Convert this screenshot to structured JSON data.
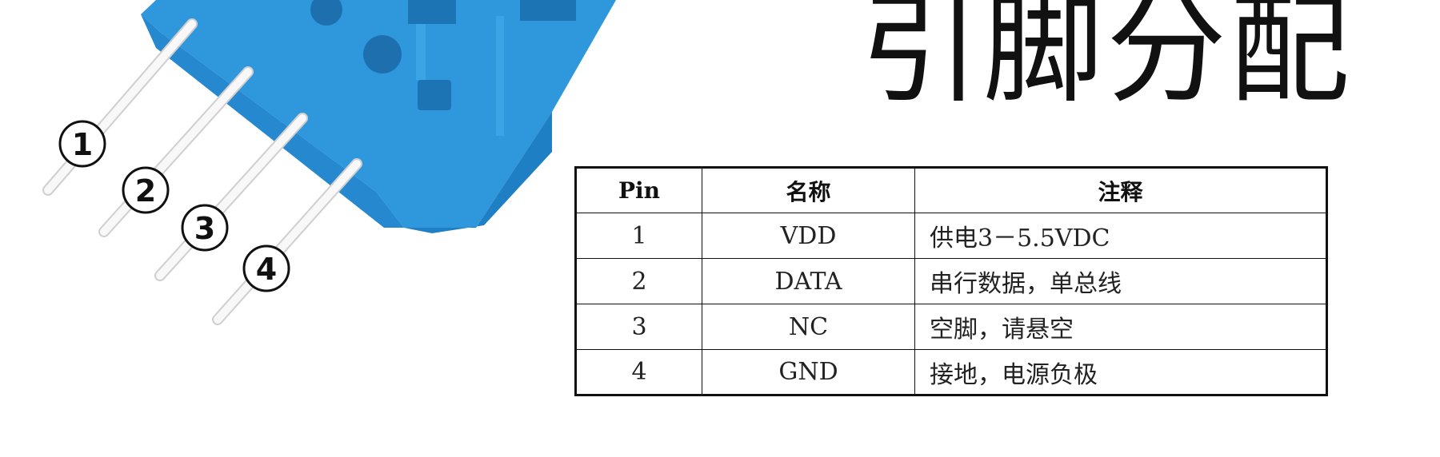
{
  "title": "引脚分配",
  "colors": {
    "sensor_body": "#2f97dc",
    "sensor_body_shadow": "#1f7fc4",
    "pin_lead": "#f4f4f4",
    "text": "#111111"
  },
  "pin_markers": [
    {
      "label": "1"
    },
    {
      "label": "2"
    },
    {
      "label": "3"
    },
    {
      "label": "4"
    }
  ],
  "table": {
    "headers": [
      "Pin",
      "名称",
      "注释"
    ],
    "rows": [
      {
        "pin": "1",
        "name": "VDD",
        "note": "供电3－5.5VDC"
      },
      {
        "pin": "2",
        "name": "DATA",
        "note": "串行数据，单总线"
      },
      {
        "pin": "3",
        "name": "NC",
        "note": "空脚，请悬空"
      },
      {
        "pin": "4",
        "name": "GND",
        "note": "接地，电源负极"
      }
    ]
  }
}
